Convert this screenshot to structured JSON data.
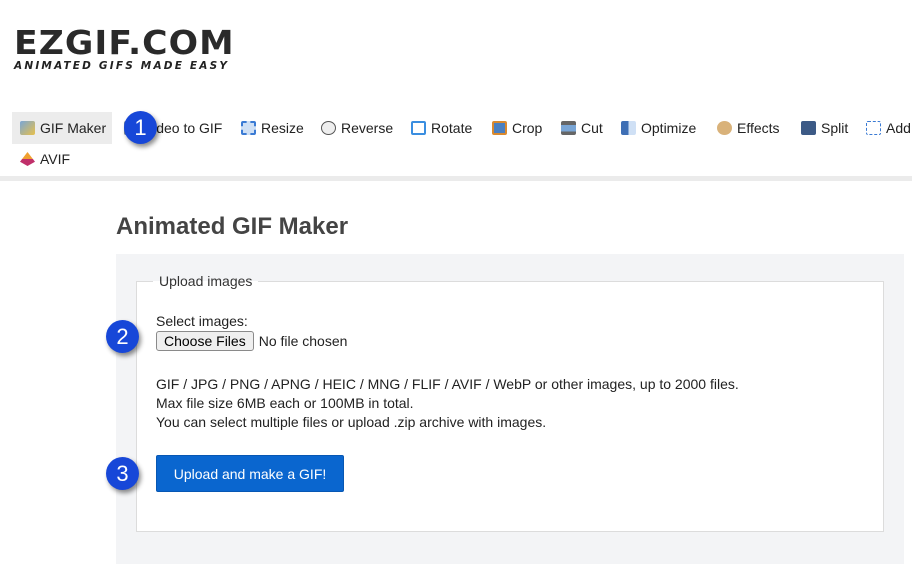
{
  "logo": {
    "name": "EZGIF.COM",
    "tagline": "ANIMATED GIFS MADE EASY"
  },
  "nav": [
    {
      "label": "GIF Maker",
      "icon": "gif-maker-icon",
      "active": true
    },
    {
      "label": "Video to GIF",
      "icon": "video-icon"
    },
    {
      "label": "Resize",
      "icon": "resize-icon"
    },
    {
      "label": "Reverse",
      "icon": "reverse-icon"
    },
    {
      "label": "Rotate",
      "icon": "rotate-icon"
    },
    {
      "label": "Crop",
      "icon": "crop-icon"
    },
    {
      "label": "Cut",
      "icon": "cut-icon"
    },
    {
      "label": "Optimize",
      "icon": "optimize-icon"
    },
    {
      "label": "Effects",
      "icon": "palette-icon"
    },
    {
      "label": "Split",
      "icon": "split-icon"
    },
    {
      "label": "Add text",
      "icon": "add-text-icon"
    },
    {
      "label": "AVIF",
      "icon": "avif-icon"
    }
  ],
  "page_title": "Animated GIF Maker",
  "form": {
    "legend": "Upload images",
    "select_label": "Select images:",
    "choose_button": "Choose Files",
    "file_status": "No file chosen",
    "info_lines": [
      "GIF / JPG / PNG / APNG / HEIC / MNG / FLIF / AVIF / WebP or other images, up to 2000 files.",
      "Max file size 6MB each or 100MB in total.",
      "You can select multiple files or upload .zip archive with images."
    ],
    "submit": "Upload and make a GIF!"
  },
  "badges": [
    "1",
    "2",
    "3"
  ],
  "colors": {
    "accent": "#0a66cf",
    "badge": "#1747d8"
  }
}
